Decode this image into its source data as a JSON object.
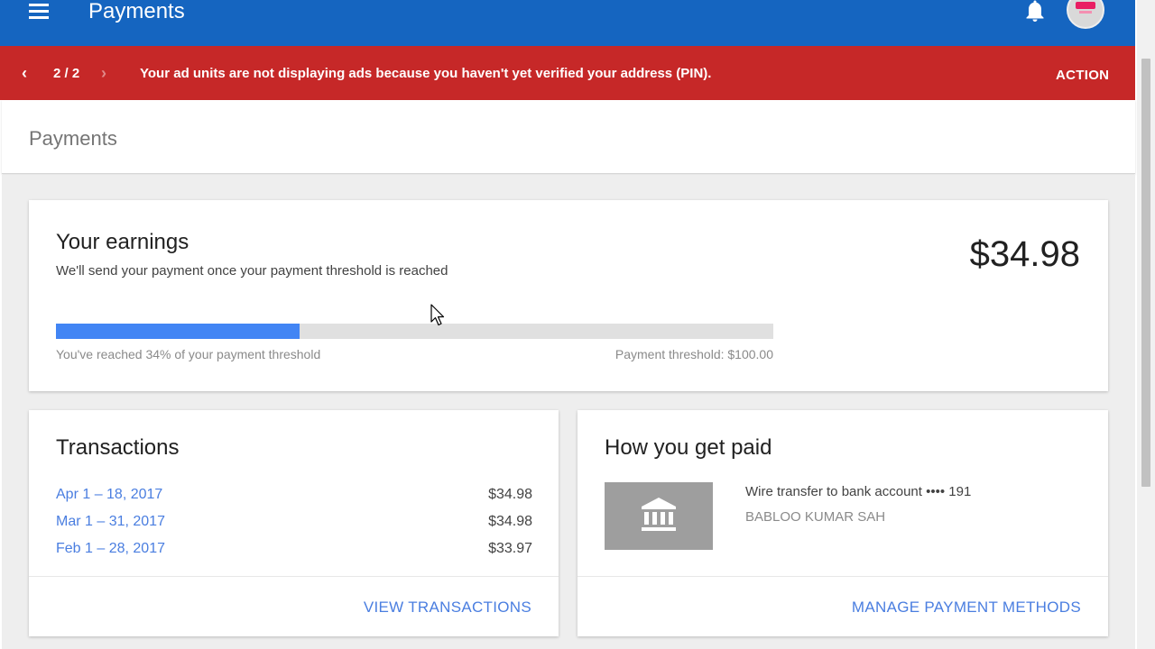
{
  "app_bar": {
    "title": "Payments",
    "menu_icon": "menu-icon",
    "notifications_icon": "bell-icon",
    "avatar_icon": "avatar-logo",
    "color": "#1565c0"
  },
  "banner": {
    "counter": "2 / 2",
    "message": "Your ad units are not displaying ads because you haven't yet verified your address (PIN).",
    "action_label": "ACTION",
    "prev_icon": "chevron-left-icon",
    "next_icon": "chevron-right-icon",
    "color": "#c62828"
  },
  "page": {
    "title": "Payments"
  },
  "earnings": {
    "heading": "Your earnings",
    "subtitle": "We'll send your payment once your payment threshold is reached",
    "amount": "$34.98",
    "progress_fraction": 0.34,
    "progress_caption": "You've reached 34% of your payment threshold",
    "threshold_caption": "Payment threshold: $100.00",
    "progress_color": "#4285f4"
  },
  "transactions": {
    "title": "Transactions",
    "rows": [
      {
        "period": "Apr 1 – 18, 2017",
        "amount": "$34.98"
      },
      {
        "period": "Mar 1 – 31, 2017",
        "amount": "$34.98"
      },
      {
        "period": "Feb 1 – 28, 2017",
        "amount": "$33.97"
      }
    ],
    "view_label": "VIEW TRANSACTIONS"
  },
  "how_paid": {
    "title": "How you get paid",
    "method": "Wire transfer to bank account •••• 191",
    "holder": "BABLOO KUMAR SAH",
    "bank_icon": "bank-icon",
    "manage_label": "MANAGE PAYMENT METHODS"
  },
  "accent_link_color": "#4a7ee0"
}
